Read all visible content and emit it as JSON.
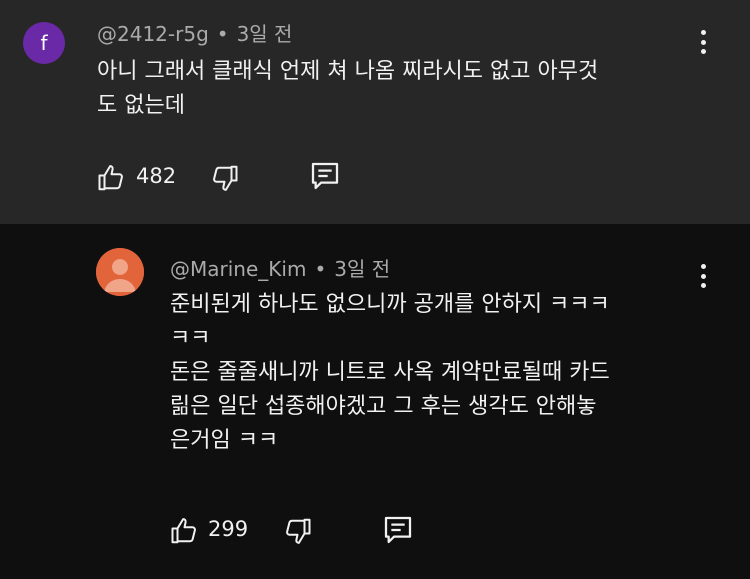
{
  "comments": [
    {
      "avatar_letter": "f",
      "avatar_color": "#6a2aa8",
      "author": "@2412-r5g",
      "separator": "•",
      "time": "3일 전",
      "lines": [
        "아니 그래서 클래식 언제 쳐 나옴 찌라시도 없고 아무것",
        "도 없는데"
      ],
      "likes": "482",
      "icons": [
        "like-icon",
        "dislike-icon",
        "reply-icon",
        "more-icon"
      ]
    },
    {
      "avatar_color": "#e2643b",
      "author": "@Marine_Kim",
      "separator": "•",
      "time": "3일 전",
      "lines": [
        "준비된게 하나도 없으니까 공개를 안하지 ㅋㅋㅋ",
        "ㅋㅋ",
        "돈은 줄줄새니까 니트로 사옥 계약만료될때 카드",
        "릶은 일단 섭종해야겠고 그 후는 생각도 안해놓",
        "은거임 ㅋㅋ"
      ],
      "likes": "299",
      "icons": [
        "like-icon",
        "dislike-icon",
        "reply-icon",
        "more-icon"
      ]
    }
  ],
  "colors": {
    "top_background": "#272727",
    "reply_background": "#0f0f0f",
    "text": "#f1f1f1",
    "meta": "#aaaaaa"
  }
}
